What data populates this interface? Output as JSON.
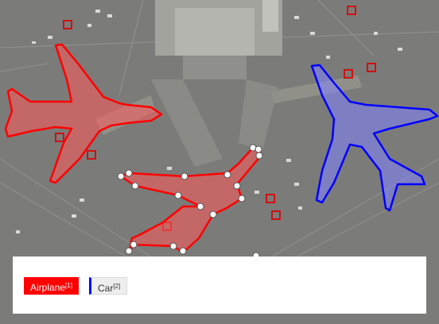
{
  "annotation_view": {
    "classes": [
      {
        "name": "Airplane",
        "index": "[1]",
        "color": "#ff0000",
        "active": true
      },
      {
        "name": "Car",
        "index": "[2]",
        "color": "#0000ff",
        "active": false
      }
    ],
    "overlay_fill_red": "rgba(255,90,90,0.55)",
    "overlay_fill_blue": "rgba(130,130,255,0.55)",
    "background_colors": {
      "tarmac": "#7d7d7b",
      "terminal": "#9a9a96"
    }
  }
}
